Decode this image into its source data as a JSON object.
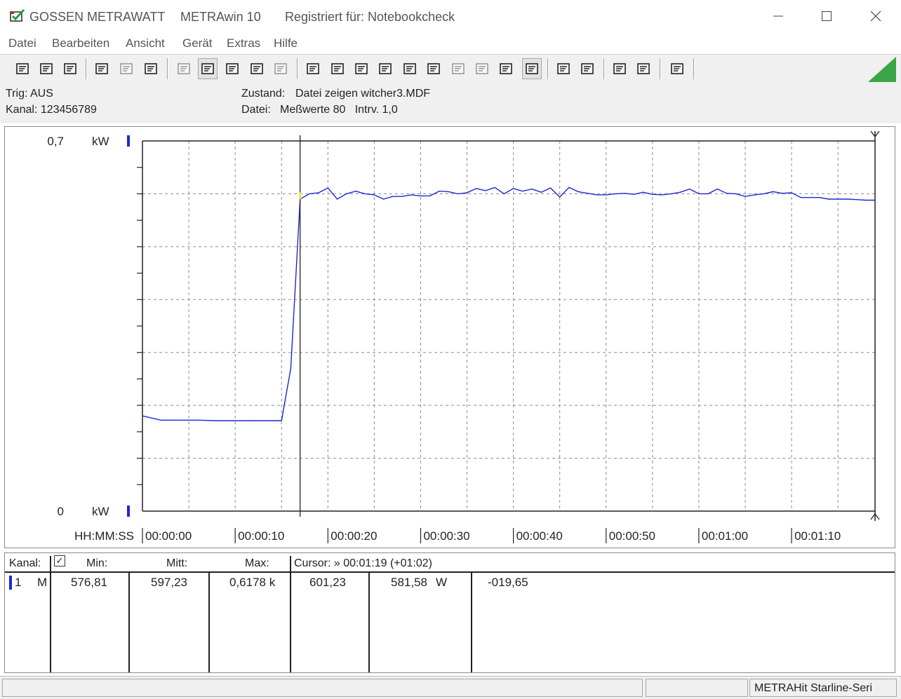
{
  "window": {
    "brand": "GOSSEN METRAWATT",
    "app": "METRAwin 10",
    "registered": "Registriert für: Notebookcheck"
  },
  "menu": [
    "Datei",
    "Bearbeiten",
    "Ansicht",
    "Gerät",
    "Extras",
    "Hilfe"
  ],
  "toolbar": {
    "icons": [
      "save-icon",
      "save-as-icon",
      "open-folder-icon",
      "device-read-icon",
      "device-settings-icon",
      "device-export-icon",
      "display-text-icon",
      "display-graph-icon",
      "crosshair-icon",
      "table-icon",
      "list-icon",
      "zoom-in-window-icon",
      "zoom-out-window-icon",
      "channel-config-icon",
      "computer-link-icon",
      "function-icon",
      "memory-icon",
      "scope-trigger-icon",
      "signal-icon",
      "convert-icon",
      "record-icon",
      "print-icon",
      "print-preview-icon",
      "measure-zoom-icon",
      "measure-search-icon",
      "message-icon"
    ],
    "accent_color": "#3aa648"
  },
  "info": {
    "trig": "Trig: AUS",
    "kanal": "Kanal: 123456789",
    "zustand_label": "Zustand:",
    "zustand_value": "Datei zeigen witcher3.MDF",
    "datei_label": "Datei:",
    "datei_value": "Meßwerte 80   Intrv. 1,0"
  },
  "chart_data": {
    "type": "line",
    "ylim": [
      0,
      0.7
    ],
    "y_top_label": "0,7",
    "y_bottom_label": "0",
    "y_unit": "kW",
    "x_axis_label": "HH:MM:SS",
    "x_tick_labels": [
      "00:00:00",
      "00:00:10",
      "00:00:20",
      "00:00:30",
      "00:00:40",
      "00:00:50",
      "00:01:00",
      "00:01:10"
    ],
    "x_range_seconds": [
      0,
      79
    ],
    "grid": true,
    "cursor_x_seconds": 17,
    "line_color": "#1d28d4",
    "series": [
      {
        "x": [
          0,
          2,
          4,
          6,
          8,
          10,
          12,
          14,
          15,
          16,
          17,
          18,
          19,
          20,
          21,
          22,
          23,
          24,
          25,
          26,
          27,
          28,
          29,
          30,
          31,
          32,
          33,
          34,
          35,
          36,
          37,
          38,
          39,
          40,
          41,
          42,
          43,
          44,
          45,
          46,
          47,
          48,
          49,
          50,
          51,
          52,
          53,
          54,
          55,
          56,
          57,
          58,
          59,
          60,
          61,
          62,
          63,
          64,
          65,
          66,
          67,
          68,
          69,
          70,
          71,
          72,
          73,
          74,
          75,
          76,
          77,
          78,
          79
        ],
        "y": [
          0.18,
          0.172,
          0.172,
          0.172,
          0.171,
          0.171,
          0.171,
          0.171,
          0.171,
          0.27,
          0.59,
          0.6,
          0.602,
          0.611,
          0.59,
          0.6,
          0.605,
          0.6,
          0.598,
          0.59,
          0.595,
          0.595,
          0.598,
          0.596,
          0.596,
          0.605,
          0.604,
          0.6,
          0.602,
          0.61,
          0.606,
          0.612,
          0.6,
          0.61,
          0.605,
          0.609,
          0.603,
          0.611,
          0.594,
          0.612,
          0.604,
          0.601,
          0.598,
          0.598,
          0.6,
          0.601,
          0.599,
          0.603,
          0.599,
          0.598,
          0.6,
          0.603,
          0.609,
          0.6,
          0.6,
          0.609,
          0.601,
          0.6,
          0.595,
          0.598,
          0.6,
          0.604,
          0.601,
          0.602,
          0.593,
          0.593,
          0.593,
          0.59,
          0.59,
          0.59,
          0.589,
          0.588,
          0.588
        ]
      }
    ]
  },
  "table": {
    "headers": {
      "kanal": "Kanal:",
      "check": "✓",
      "min": "Min:",
      "mitt": "Mitt:",
      "max": "Max:",
      "cursor": "Cursor: » 00:01:19 (+01:02)"
    },
    "row": {
      "channel": "1",
      "mode": "M",
      "min": "576,81",
      "mitt": "597,23",
      "max": "0,6178 k",
      "cursor_a": "601,23",
      "cursor_b": "581,58",
      "unit": "W",
      "diff": "-019,65"
    },
    "marker_color": "#1d28d4"
  },
  "status": {
    "device": "METRAHit Starline-Seri"
  }
}
